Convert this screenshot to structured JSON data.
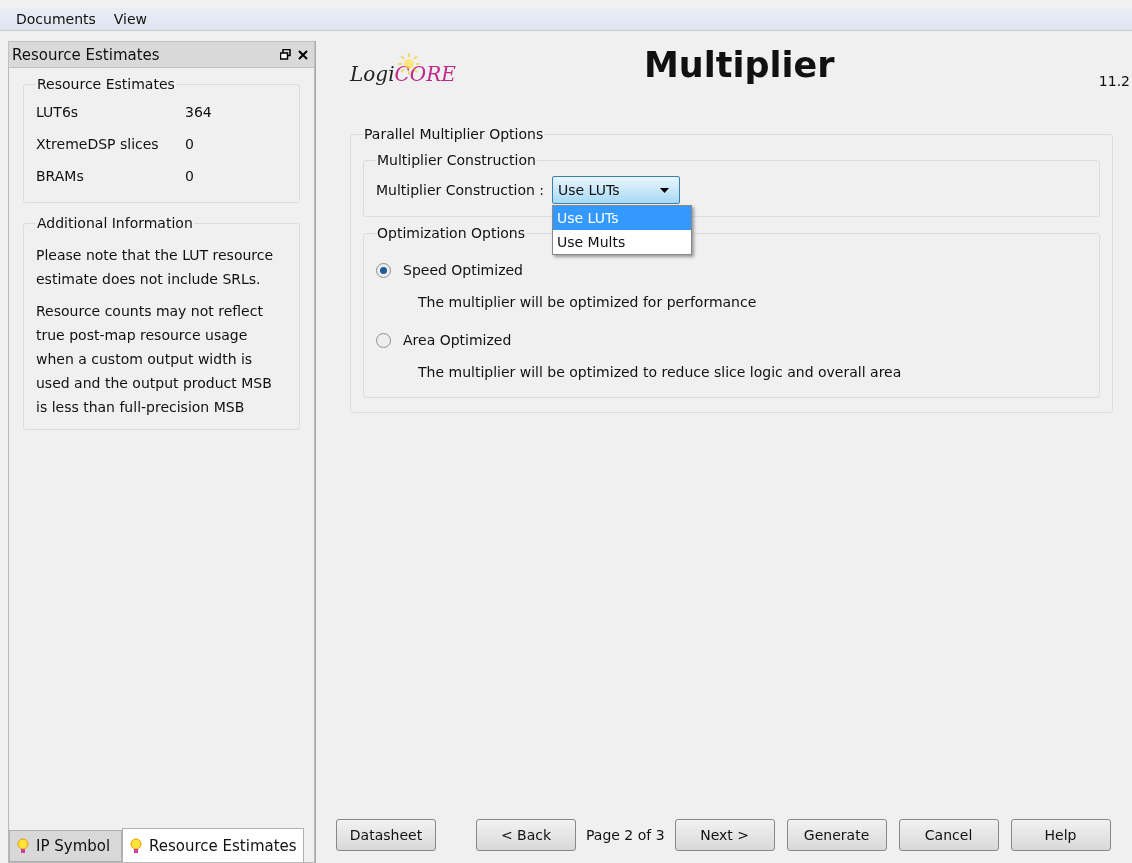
{
  "menu": [
    "Documents",
    "View"
  ],
  "left_panel": {
    "title": "Resource Estimates",
    "estimates": {
      "title": "Resource Estimates",
      "rows": [
        {
          "label": "LUT6s",
          "value": "364"
        },
        {
          "label": "XtremeDSP slices",
          "value": "0"
        },
        {
          "label": "BRAMs",
          "value": "0"
        }
      ]
    },
    "info": {
      "title": "Additional Information",
      "paragraphs": [
        "Please note that the LUT resource estimate does not include SRLs.",
        "Resource counts may not reflect true post-map resource usage when a custom output width is used and the output product MSB is less than full-precision MSB"
      ]
    },
    "tabs": [
      {
        "label": "IP Symbol",
        "selected": false
      },
      {
        "label": "Resource Estimates",
        "selected": true
      }
    ]
  },
  "logo": [
    "Logi",
    "CORE"
  ],
  "title": "Multiplier",
  "version": "11.2",
  "options": {
    "title": "Parallel Multiplier Options",
    "construction": {
      "title": "Multiplier Construction",
      "label": "Multiplier Construction :",
      "value": "Use LUTs",
      "expanded": true,
      "choices": [
        {
          "label": "Use LUTs",
          "selected": true
        },
        {
          "label": "Use Mults",
          "selected": false
        }
      ]
    },
    "optimization": {
      "title": "Optimization Options",
      "choices": [
        {
          "label": "Speed Optimized",
          "selected": true,
          "description": "The multiplier will be optimized for performance"
        },
        {
          "label": "Area Optimized",
          "selected": false,
          "description": "The multiplier will be optimized to reduce slice logic and overall area"
        }
      ]
    }
  },
  "footer": {
    "buttons_left": [
      "Datasheet",
      "< Back"
    ],
    "page": "Page 2 of 3",
    "buttons_right": [
      "Next >",
      "Generate",
      "Cancel",
      "Help"
    ]
  }
}
